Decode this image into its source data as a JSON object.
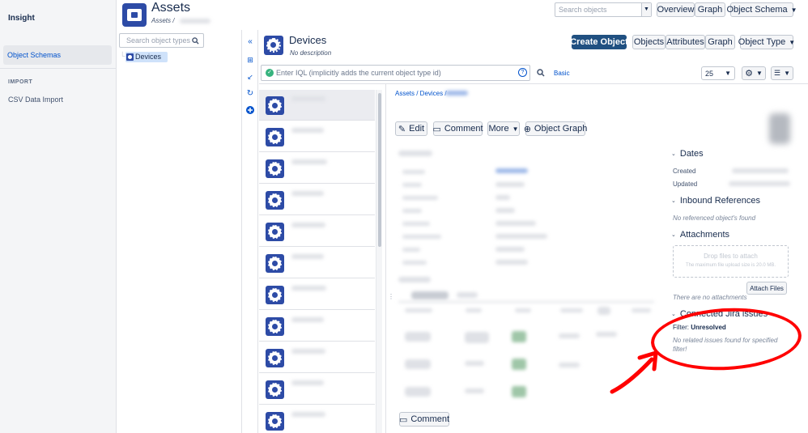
{
  "leftnav": {
    "title": "Insight",
    "items": [
      {
        "label": "Object Schemas"
      }
    ],
    "section": "IMPORT",
    "import_link": "CSV Data Import"
  },
  "header": {
    "title": "Assets",
    "breadcrumb": "Assets /",
    "search_placeholder": "Search objects",
    "buttons": {
      "overview": "Overview",
      "graph": "Graph",
      "object_schema": "Object Schema"
    }
  },
  "tree": {
    "search_placeholder": "Search object types",
    "nodes": [
      {
        "label": "Devices"
      }
    ]
  },
  "object_type": {
    "title": "Devices",
    "description": "No description",
    "buttons": {
      "create": "Create Object",
      "objects": "Objects",
      "attributes": "Attributes",
      "graph": "Graph",
      "object_type": "Object Type"
    }
  },
  "iql": {
    "placeholder": "Enter IQL (implicitly adds the current object type id)",
    "mode": "Basic",
    "page_size": "25"
  },
  "detail": {
    "breadcrumb": "Assets / Devices /",
    "actions": {
      "edit": "Edit",
      "comment": "Comment",
      "more": "More",
      "object_graph": "Object Graph"
    },
    "bottom_comment": "Comment",
    "dates": {
      "heading": "Dates",
      "created_label": "Created",
      "updated_label": "Updated"
    },
    "inbound": {
      "heading": "Inbound References",
      "empty": "No referenced object's found"
    },
    "attachments": {
      "heading": "Attachments",
      "drop": "Drop files to attach",
      "max": "The maximum file upload size is 20.0 MB.",
      "attach_button": "Attach Files",
      "empty": "There are no attachments"
    },
    "jira": {
      "heading": "Connected Jira issues",
      "filter_label": "Filter:",
      "filter_value": "Unresolved",
      "empty": "No related issues found for specified filter!"
    }
  },
  "colors": {
    "primary": "#2d4ba6",
    "create_button": "#205081",
    "link": "#0052cc",
    "annotation": "#ff0000"
  }
}
